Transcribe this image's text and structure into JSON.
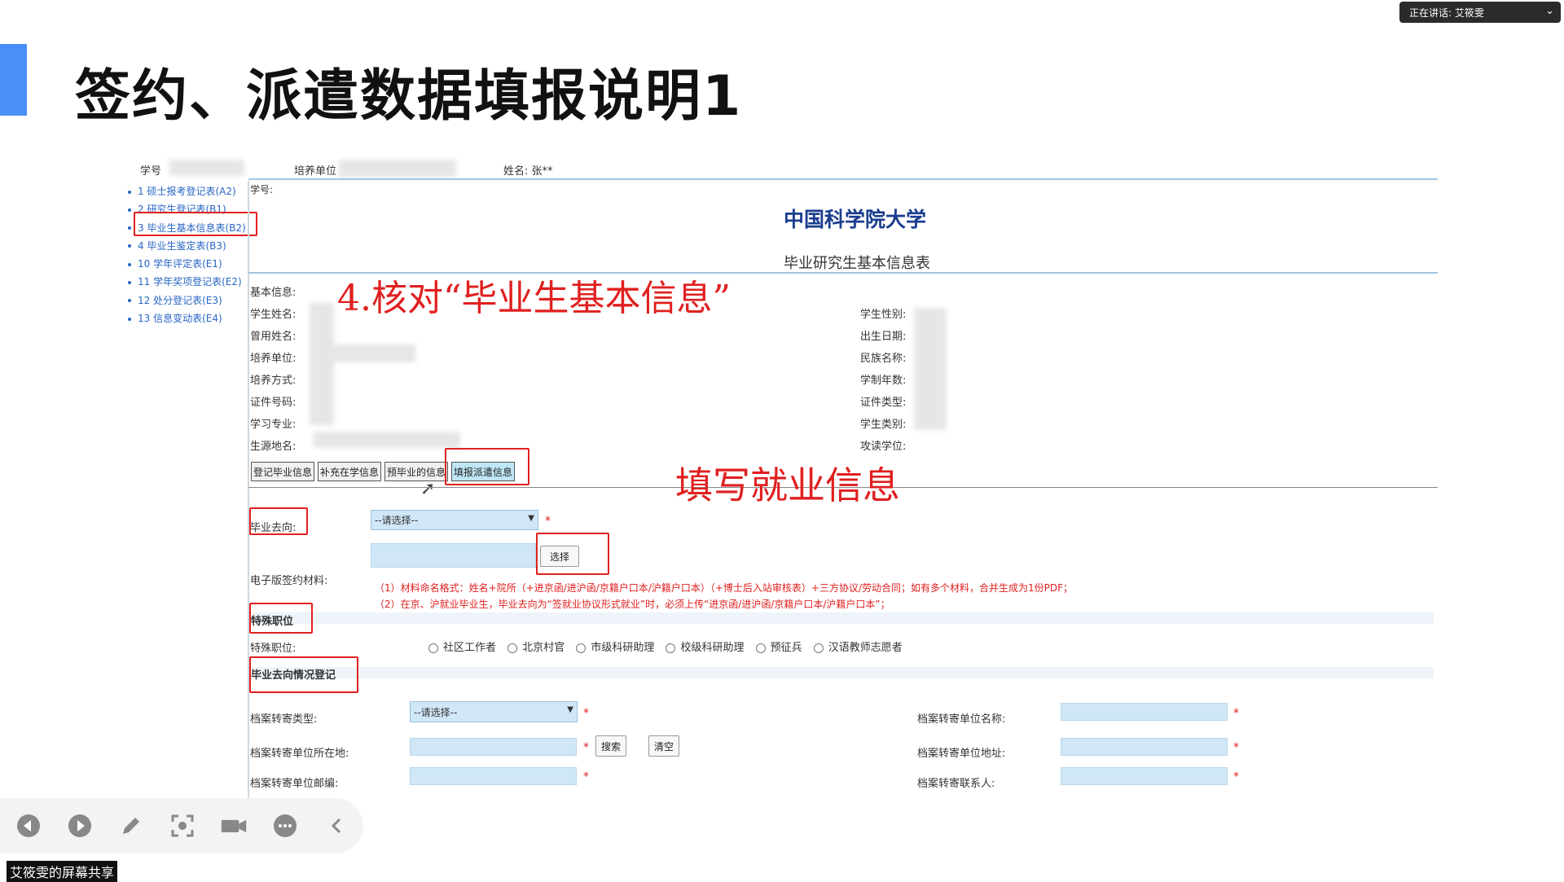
{
  "slide": {
    "title": "签约、派遣数据填报说明1"
  },
  "speaker": {
    "label": "正在讲话: 艾筱雯"
  },
  "header": {
    "student_id_label": "学号",
    "unit_label": "培养单位",
    "name_label": "姓名: 张**"
  },
  "sidebar": {
    "items": [
      {
        "label": "1 硕士报考登记表(A2)"
      },
      {
        "label": "2 研究生登记表(B1)"
      },
      {
        "label": "3 毕业生基本信息表(B2)"
      },
      {
        "label": "4 毕业生鉴定表(B3)"
      },
      {
        "label": "10 学年评定表(E1)"
      },
      {
        "label": "11 学年奖项登记表(E2)"
      },
      {
        "label": "12 处分登记表(E3)"
      },
      {
        "label": "13 信息变动表(E4)"
      }
    ]
  },
  "form": {
    "id_label": "学号:",
    "university": "中国科学院大学",
    "form_title": "毕业研究生基本信息表",
    "basic_info_label": "基本信息:",
    "left_fields": [
      "学生姓名:",
      "曾用姓名:",
      "培养单位:",
      "培养方式:",
      "证件号码:",
      "学习专业:",
      "生源地名:"
    ],
    "right_fields": [
      "学生性别:",
      "出生日期:",
      "民族名称:",
      "学制年数:",
      "证件类型:",
      "学生类别:",
      "攻读学位:"
    ],
    "tabs": [
      "登记毕业信息",
      "补充在学信息",
      "预毕业的信息",
      "填报派遣信息"
    ],
    "destination_label": "毕业去向:",
    "destination_select": "--请选择--",
    "choose_button": "选择",
    "esign_label": "电子版签约材料:",
    "notes": [
      "（1）材料命名格式：姓名+院所（+进京函/进沪函/京籍户口本/沪籍户口本）（+博士后入站审核表）+三方协议/劳动合同；如有多个材料，合并生成为1份PDF；",
      "（2）在京、沪就业毕业生，毕业去向为“签就业协议形式就业”时，必须上传“进京函/进沪函/京籍户口本/沪籍户口本”；"
    ],
    "special_section": "特殊职位",
    "special_label": "特殊职位:",
    "special_options": [
      "社区工作者",
      "北京村官",
      "市级科研助理",
      "校级科研助理",
      "预征兵",
      "汉语教师志愿者"
    ],
    "dest_section": "毕业去向情况登记",
    "archive_type_label": "档案转寄类型:",
    "archive_type_select": "--请选择--",
    "archive_unit_name_label": "档案转寄单位名称:",
    "archive_unit_loc_label": "档案转寄单位所在地:",
    "search_button": "搜索",
    "clear_button": "清空",
    "archive_unit_addr_label": "档案转寄单位地址:",
    "archive_zip_label": "档案转寄单位邮编:",
    "archive_contact_label": "档案转寄联系人:",
    "required_mark": "*"
  },
  "annotations": {
    "step4": "4.核对“毕业生基本信息”",
    "fill_job": "填写就业信息"
  },
  "share_label": "艾筱雯的屏幕共享",
  "colors": {
    "accent": "#4a8ff7",
    "annotation_red": "#e02020",
    "link_blue": "#2866c4",
    "field_blue": "#cfe7f7"
  }
}
